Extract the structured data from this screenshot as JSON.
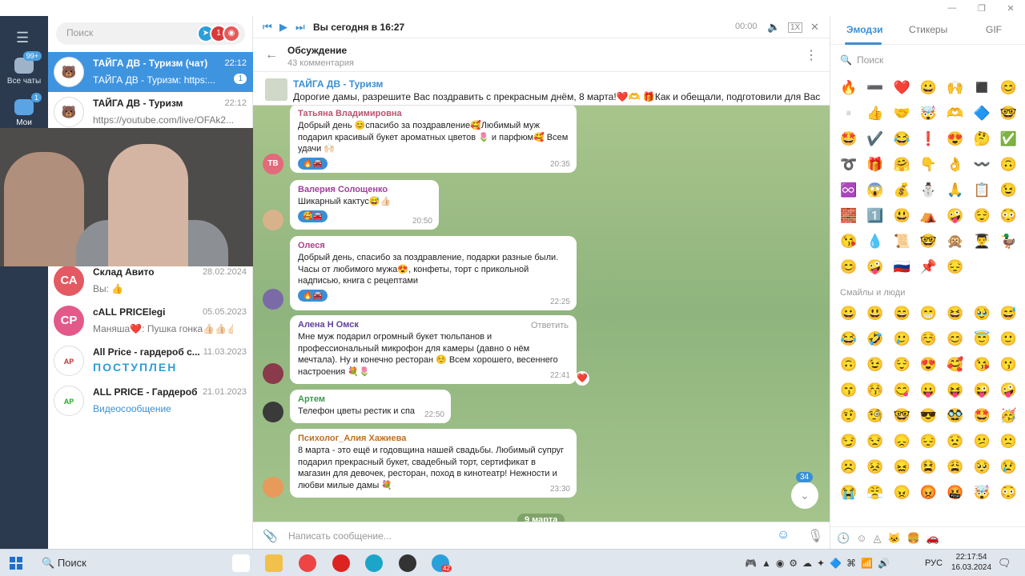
{
  "rail": {
    "all_chats": {
      "label": "Все чаты",
      "badge": "99+"
    },
    "mine": {
      "label": "Мои",
      "badge": "1"
    }
  },
  "chatlist": {
    "search_placeholder": "Поиск",
    "chats": [
      {
        "name": "ТАЙГА ДВ - Туризм (чат)",
        "time": "22:12",
        "preview": "ТАЙГА ДВ - Туризм: https:...",
        "count": "1"
      },
      {
        "name": "ТАЙГА ДВ - Туризм",
        "time": "22:12",
        "preview": "https://youtube.com/live/OFAk2..."
      },
      {
        "name": "Склад Авито",
        "time": "28.02.2024",
        "preview": "Вы: 👍",
        "avatar": "СА"
      },
      {
        "name": "cALL PRICElegi",
        "time": "05.05.2023",
        "preview": "Маняша❤️: Пушка гонка👍🏻👍🏻👍🏻...",
        "avatar": "СР"
      },
      {
        "name": "All Price - гардероб с...",
        "time": "11.03.2023",
        "preview": "ПОСТУПЛЕН"
      },
      {
        "name": "ALL PRICE - Гардероб",
        "time": "21.01.2023",
        "preview": "Видеосообщение"
      }
    ]
  },
  "player": {
    "title": "Вы сегодня в 16:27",
    "time": "00:00",
    "speed": "1X"
  },
  "header": {
    "title": "Обсуждение",
    "subtitle": "43 комментария"
  },
  "pinned": {
    "title": "ТАЙГА ДВ - Туризм",
    "text": "Дорогие дамы, разрешите Вас поздравить с прекрасным днём, 8 марта!❤️🫶 🎁Как и обещали, подготовили для Вас розы..."
  },
  "messages": [
    {
      "author": "Татьяна Владимировна",
      "avatar": "ТВ",
      "text": "Добрый день 😊спасибо за поздравление🥰Любимый муж подарил красивый букет ароматных цветов 🌷 и парфюм🥰 Всем удачи 🙌🏻",
      "reaction": "🔥🚘",
      "time": "20:35"
    },
    {
      "author": "Валерия Солощенко",
      "text": "Шикарный кактус😅👍🏻",
      "reaction": "🥰🚘",
      "time": "20:50"
    },
    {
      "author": "Олеся",
      "text": "Добрый день, спасибо за поздравление, подарки разные были. Часы от любимого мужа😍, конфеты, торт с прикольной надписью, книга с рецептами",
      "reaction": "🔥🚘",
      "time": "22:25"
    },
    {
      "author": "Алена Н Омск",
      "reply": "Ответить",
      "text": "Мне муж подарил огромный букет тюльпанов и профессиональный микрофон для камеры (давно о нём мечтала). Ну и конечно ресторан ☺️ Всем хорошего, весеннего настроения 💐🌷",
      "time": "22:41",
      "heart": "❤️"
    },
    {
      "author": "Артем",
      "text": "Телефон цветы рестик и спа",
      "time": "22:50"
    },
    {
      "author": "Психолог_Алия Хажиева",
      "text": "8 марта - это ещё и годовщина нашей свадьбы. Любимый супруг подарил прекрасный букет, свадебный торт, сертификат в магазин для девочек, ресторан, поход в кинотеатр! Нежности и любви милые дамы 💐",
      "time": "23:30"
    }
  ],
  "date_badge": "9 марта",
  "unread_count": "34",
  "composer": {
    "placeholder": "Написать сообщение..."
  },
  "emoji_panel": {
    "tabs": [
      "Эмодзи",
      "Стикеры",
      "GIF"
    ],
    "search_placeholder": "Поиск",
    "recent": [
      "🔥",
      "➖",
      "❤️",
      "😀",
      "🙌",
      "◼️",
      "😊",
      "▫️",
      "👍",
      "🤝",
      "🤯",
      "🫶",
      "🔷",
      "🤓",
      "🤩",
      "✔️",
      "😂",
      "❗",
      "😍",
      "🤔",
      "✅",
      "➰",
      "🎁",
      "🤗",
      "👇",
      "👌",
      "〰️",
      "🙃",
      "♾️",
      "😱",
      "💰",
      "⛄",
      "🙏",
      "📋",
      "😉",
      "🧱",
      "1️⃣",
      "😃",
      "⛺",
      "🤪",
      "😌",
      "😳",
      "😘",
      "💧",
      "📜",
      "🤓",
      "🙊",
      "👨‍🎓",
      "🦆",
      "😊",
      "🤪",
      "🇷🇺",
      "📌",
      "😔"
    ],
    "section_label": "Смайлы и люди",
    "smileys": [
      "😀",
      "😃",
      "😄",
      "😁",
      "😆",
      "🥹",
      "😅",
      "😂",
      "🤣",
      "🥲",
      "☺️",
      "😊",
      "😇",
      "🙂",
      "🙃",
      "😉",
      "😌",
      "😍",
      "🥰",
      "😘",
      "😗",
      "😙",
      "😚",
      "😋",
      "😛",
      "😝",
      "😜",
      "🤪",
      "🤨",
      "🧐",
      "🤓",
      "😎",
      "🥸",
      "🤩",
      "🥳",
      "😏",
      "😒",
      "😞",
      "😔",
      "😟",
      "😕",
      "🙁",
      "☹️",
      "😣",
      "😖",
      "😫",
      "😩",
      "🥺",
      "😢",
      "😭",
      "😤",
      "😠",
      "😡",
      "🤬",
      "🤯",
      "😳",
      "🥵",
      "🥶",
      "😶‍🌫️",
      "😱",
      "😨",
      "😰",
      "😥"
    ]
  },
  "taskbar": {
    "search": "Поиск",
    "lang": "РУС",
    "time": "22:17:54",
    "date": "16.03.2024",
    "telegram_badge": "42"
  },
  "colors": {
    "accent": "#3a8fd4",
    "rail": "#2b3a4f",
    "active_chat": "#3f94e0",
    "wallpaper": "#9dbc82"
  }
}
